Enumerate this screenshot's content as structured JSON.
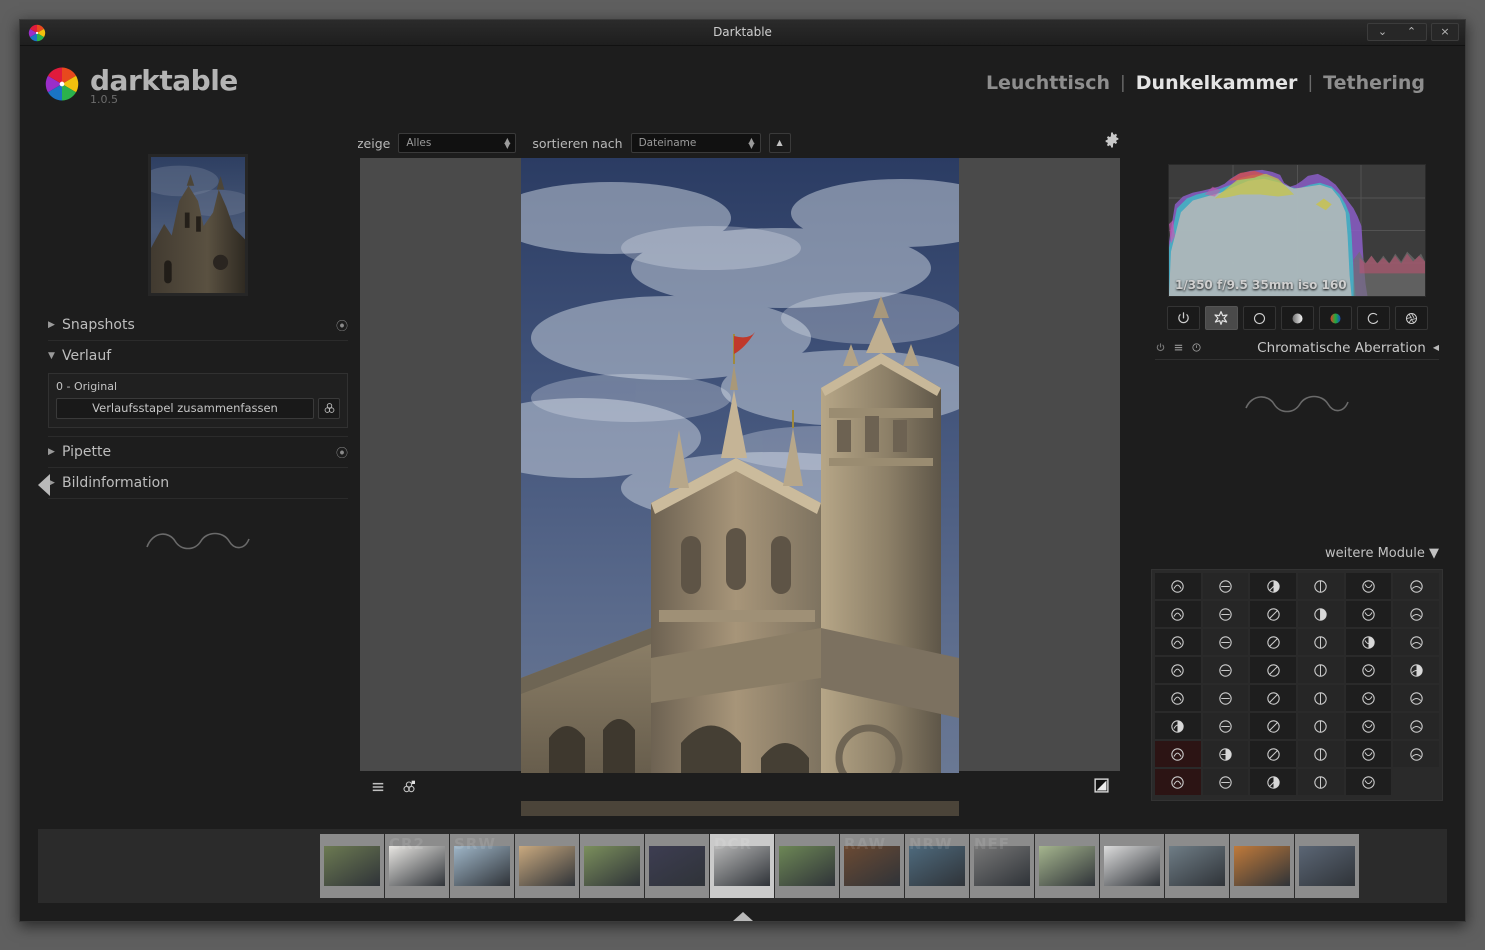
{
  "window": {
    "title": "Darktable",
    "app_icon": "darktable-logo-icon",
    "controls": [
      {
        "name": "minimize-button",
        "glyph": "⌄"
      },
      {
        "name": "maximize-button",
        "glyph": "⌃"
      },
      {
        "name": "close-button",
        "glyph": "×"
      }
    ]
  },
  "branding": {
    "name": "darktable",
    "version": "1.0.5"
  },
  "nav": {
    "items": [
      {
        "label": "Leuchttisch",
        "active": false
      },
      {
        "label": "Dunkelkammer",
        "active": true
      },
      {
        "label": "Tethering",
        "active": false
      }
    ],
    "separator": "|"
  },
  "filterbar": {
    "show_label": "zeige",
    "show_value": "Alles",
    "sort_label": "sortieren nach",
    "sort_value": "Dateiname",
    "sort_direction_glyph": "▲",
    "gear_icon": "gear-icon"
  },
  "left_panel": {
    "sections": [
      {
        "label": "Snapshots",
        "expanded": false,
        "triangle": "▶",
        "reset": "⦿"
      },
      {
        "label": "Verlauf",
        "expanded": true,
        "triangle": "▼",
        "reset": ""
      },
      {
        "label": "Pipette",
        "expanded": false,
        "triangle": "▶",
        "reset": "⦿"
      },
      {
        "label": "Bildinformation",
        "expanded": false,
        "triangle": "▶",
        "reset": ""
      }
    ],
    "history": {
      "item": "0 - Original",
      "compress_button": "Verlaufsstapel zusammenfassen",
      "create_style_icon": "create-style-icon"
    },
    "collapse_arrow": "left-panel-collapse-arrow"
  },
  "right_panel": {
    "histogram": {
      "exif": "1/350 f/9.5 35mm iso 160",
      "grid_cols": 4,
      "grid_rows": 4
    },
    "module_groups": [
      {
        "name": "active-modules-group",
        "icon": "power-icon",
        "active": false
      },
      {
        "name": "favorite-modules-group",
        "icon": "star-icon",
        "active": true
      },
      {
        "name": "basic-group",
        "icon": "circle-outline-icon",
        "active": false
      },
      {
        "name": "tone-group",
        "icon": "gradient-circle-icon",
        "active": false
      },
      {
        "name": "color-group",
        "icon": "color-circle-icon",
        "active": false
      },
      {
        "name": "correction-group",
        "icon": "curve-icon",
        "active": false
      },
      {
        "name": "effects-group",
        "icon": "aperture-icon",
        "active": false
      }
    ],
    "active_module": {
      "title": "Chromatische Aberration",
      "power_icon": "power-toggle-icon",
      "presets_icon": "presets-menu-icon",
      "reset_icon": "reset-icon",
      "collapse_triangle": "◀"
    },
    "more_modules_label": "weitere Module",
    "more_modules_triangle": "▼",
    "module_grid": {
      "columns": 6,
      "icons": [
        "sharpen-icon",
        "framing-icon",
        "whitebalance-icon",
        "lowlight-icon",
        "contrast-icon",
        "vignetting-icon",
        "splittoning-icon",
        "inputcolor-icon",
        "colorzones-icon",
        "circle-plain-icon",
        "grain-icon",
        "channelmixer-icon",
        "basecurve-icon",
        "exposure-icon",
        "velvia-icon",
        "watermark-icon",
        "spots-icon",
        "demosaic-icon",
        "bw-icon",
        "levels-icon",
        "nightvision-icon",
        "colorbalance-icon",
        "histogram-eq-icon",
        "sphere-icon",
        "tonecurve-icon",
        "bloom-icon",
        "lens-icon",
        "circle-thin-icon",
        "circle-thin2-icon",
        "borders-icon",
        "colorcontrast-icon",
        "rotate-icon",
        "lowpass-icon",
        "colormapping-icon",
        "gradient-fill-icon",
        "invert-icon",
        "zonesystem-icon",
        "profile-icon",
        "highpass-icon",
        "graduated-nd-icon",
        "monochrome-icon",
        "colorchecker-icon",
        "colorlut-icon",
        "equalizer-icon",
        "highlight-icon",
        "temperature-icon",
        "soften-icon"
      ],
      "highlighted_cells": [
        36,
        42
      ]
    },
    "collapse_arrow": "right-panel-collapse-arrow"
  },
  "center": {
    "photo_alt": "cathedral-tower-photo",
    "toolbar": {
      "filmstrip_toggle_icon": "list-view-icon",
      "grouping_icon": "image-grouping-icon",
      "overexposed_icon": "overexposure-warning-icon"
    }
  },
  "filmstrip": {
    "thumbnails": [
      {
        "name": "thumb-tower",
        "label": "",
        "selected": false,
        "tone": "#6c7a52"
      },
      {
        "name": "thumb-cups",
        "label": "CR2",
        "selected": false,
        "tone": "#e8e6e2"
      },
      {
        "name": "thumb-mountains",
        "label": "SRW",
        "selected": false,
        "tone": "#9fb6c8"
      },
      {
        "name": "thumb-hair",
        "label": "",
        "selected": false,
        "tone": "#c9a97f"
      },
      {
        "name": "thumb-field",
        "label": "",
        "selected": false,
        "tone": "#7b8f5c"
      },
      {
        "name": "thumb-noise",
        "label": "",
        "selected": false,
        "tone": "#3d3d52"
      },
      {
        "name": "thumb-bw-stone",
        "label": "DCR",
        "selected": true,
        "tone": "#b5b5b5"
      },
      {
        "name": "thumb-garden",
        "label": "",
        "selected": false,
        "tone": "#6d8756"
      },
      {
        "name": "thumb-table",
        "label": "RAW",
        "selected": false,
        "tone": "#6b4a33"
      },
      {
        "name": "thumb-harbour",
        "label": "NRW",
        "selected": false,
        "tone": "#4e6a7d"
      },
      {
        "name": "thumb-aerial-bw",
        "label": "NEF",
        "selected": false,
        "tone": "#777777"
      },
      {
        "name": "thumb-blossom",
        "label": "",
        "selected": false,
        "tone": "#a5b58e"
      },
      {
        "name": "thumb-discs",
        "label": "",
        "selected": false,
        "tone": "#dcdcdc"
      },
      {
        "name": "thumb-cliff",
        "label": "",
        "selected": false,
        "tone": "#6f7d86"
      },
      {
        "name": "thumb-sunset",
        "label": "",
        "selected": false,
        "tone": "#c07a3a"
      },
      {
        "name": "thumb-city",
        "label": "",
        "selected": false,
        "tone": "#5b6675"
      }
    ],
    "marker": "selected-thumb-marker",
    "collapse_triangle": "▼"
  },
  "colors": {
    "panel_bg": "#1d1d1d",
    "canvas_bg": "#4a4a4a",
    "text": "#bdbdbd",
    "text_active": "#e4e4e4",
    "accent_blue": "#5b7fb8"
  }
}
